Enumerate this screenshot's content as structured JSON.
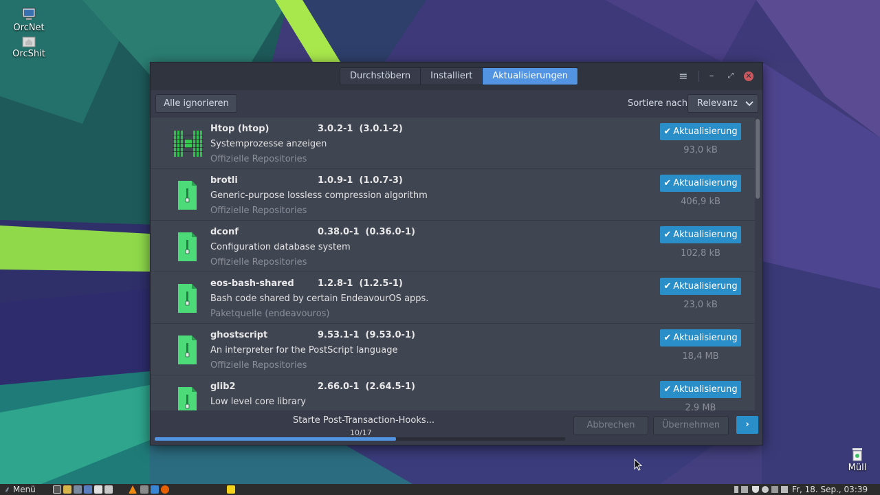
{
  "desktop": {
    "icons": [
      {
        "label": "OrcNet"
      },
      {
        "label": "OrcShit"
      },
      {
        "label": "Müll"
      }
    ]
  },
  "window": {
    "tabs": [
      {
        "label": "Durchstöbern",
        "active": false
      },
      {
        "label": "Installiert",
        "active": false
      },
      {
        "label": "Aktualisierungen",
        "active": true
      }
    ],
    "controls": {
      "menu": "≡",
      "minimize": "–",
      "restore": "⤢",
      "close": "✕"
    }
  },
  "toolbar": {
    "ignore_all_label": "Alle ignorieren",
    "sort_label": "Sortiere nach",
    "sort_value": "Relevanz"
  },
  "packages": [
    {
      "name": "Htop (htop)",
      "version": "3.0.2-1  (3.0.1-2)",
      "description": "Systemprozesse anzeigen",
      "repo": "Offizielle Repositories",
      "button": "Aktualisierung",
      "size": "93,0 kB",
      "icon": "htop-icon"
    },
    {
      "name": "brotli",
      "version": "1.0.9-1  (1.0.7-3)",
      "description": "Generic-purpose lossless compression algorithm",
      "repo": "Offizielle Repositories",
      "button": "Aktualisierung",
      "size": "406,9 kB",
      "icon": "archive-icon"
    },
    {
      "name": "dconf",
      "version": "0.38.0-1  (0.36.0-1)",
      "description": "Configuration database system",
      "repo": "Offizielle Repositories",
      "button": "Aktualisierung",
      "size": "102,8 kB",
      "icon": "archive-icon"
    },
    {
      "name": "eos-bash-shared",
      "version": "1.2.8-1  (1.2.5-1)",
      "description": "Bash code shared by certain EndeavourOS apps.",
      "repo": "Paketquelle (endeavouros)",
      "button": "Aktualisierung",
      "size": "23,0 kB",
      "icon": "archive-icon"
    },
    {
      "name": "ghostscript",
      "version": "9.53.1-1  (9.53.0-1)",
      "description": "An interpreter for the PostScript language",
      "repo": "Offizielle Repositories",
      "button": "Aktualisierung",
      "size": "18,4 MB",
      "icon": "archive-icon"
    },
    {
      "name": "glib2",
      "version": "2.66.0-1  (2.64.5-1)",
      "description": "Low level core library",
      "repo": "",
      "button": "Aktualisierung",
      "size": "2,9 MB",
      "icon": "archive-icon"
    }
  ],
  "footer": {
    "status": "Starte Post-Transaction-Hooks...",
    "progress_text": "10/17",
    "progress_fraction": 0.588,
    "cancel_label": "Abbrechen",
    "apply_label": "Übernehmen",
    "next_label": "›"
  },
  "taskbar": {
    "menu_label": "Menü",
    "clock": "Fr, 18. Sep., 03:39"
  },
  "colors": {
    "accent": "#5294e2",
    "update_button": "#2a8ec9",
    "close_button": "#cc575d",
    "package_icon_green": "#4ddb7a"
  }
}
